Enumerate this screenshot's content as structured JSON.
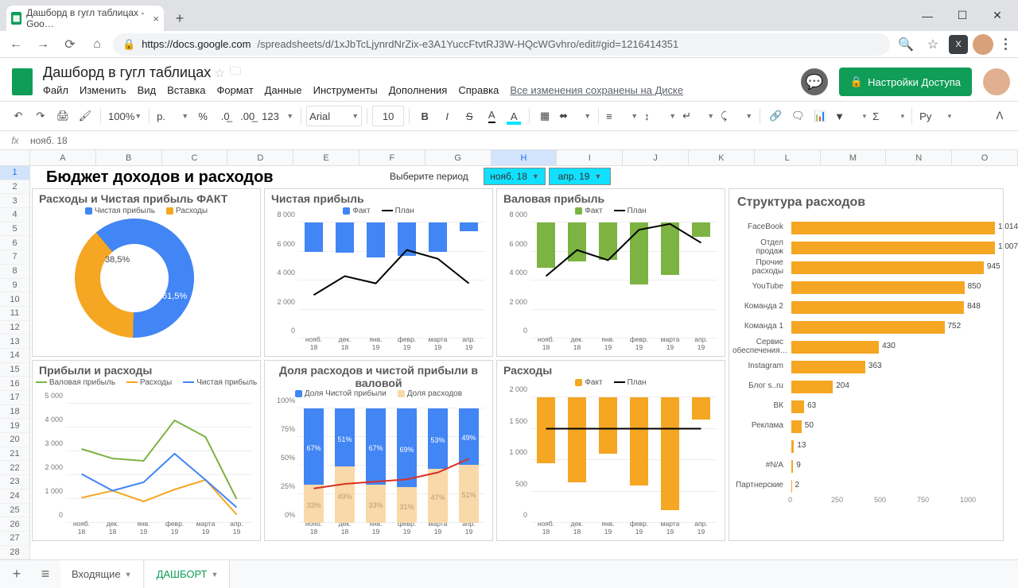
{
  "browser": {
    "tab_title": "Дашборд в гугл таблицах - Goo…",
    "url_host": "https://docs.google.com",
    "url_path": "/spreadsheets/d/1xJbTcLjynrdNrZix-e3A1YuccFtvtRJ3W-HQcWGvhro/edit#gid=1216414351"
  },
  "sheets": {
    "doc_title": "Дашборд в гугл таблицах",
    "menu": [
      "Файл",
      "Изменить",
      "Вид",
      "Вставка",
      "Формат",
      "Данные",
      "Инструменты",
      "Дополнения",
      "Справка"
    ],
    "saved_text": "Все изменения сохранены на Диске",
    "share_label": "Настройки Доступа",
    "font_name": "Arial",
    "font_size": "10",
    "zoom": "100%",
    "currency": "р.",
    "script_label": "Ру",
    "formula_cell": "нояб. 18",
    "tab_incoming": "Входящие",
    "tab_dashboard": "ДАШБОРТ"
  },
  "grid": {
    "cols": [
      "A",
      "B",
      "C",
      "D",
      "E",
      "F",
      "G",
      "H",
      "I",
      "J",
      "K",
      "L",
      "M",
      "N",
      "O"
    ],
    "selected_col_idx": 7,
    "rows": 28
  },
  "dashboard_title": "Бюджет доходов и расходов",
  "period_label": "Выберите период",
  "period_from": "нояб. 18",
  "period_to": "апр. 19",
  "months": [
    "нояб. 18",
    "дек. 18",
    "янв. 19",
    "февр. 19",
    "марта 19",
    "апр. 19"
  ],
  "box1": {
    "title": "Расходы и Чистая прибыль ФАКТ",
    "legend_profit": "Чистая прибыль",
    "legend_expense": "Расходы"
  },
  "box2": {
    "title": "Чистая прибыль",
    "legend_fact": "Факт",
    "legend_plan": "План"
  },
  "box3": {
    "title": "Валовая прибыль",
    "legend_fact": "Факт",
    "legend_plan": "План"
  },
  "box4": {
    "title": "Прибыли и расходы",
    "legend_gross": "Валовая прибыль",
    "legend_expense": "Расходы",
    "legend_net": "Чистая прибыль"
  },
  "box5": {
    "title": "Доля расходов и чистой прибыли в валовой",
    "legend_profit": "Доля Чистой прибыли",
    "legend_expense": "Доля расходов"
  },
  "box6": {
    "title": "Расходы",
    "legend_fact": "Факт",
    "legend_plan": "План"
  },
  "box7": {
    "title": "Структура расходов"
  },
  "chart_data": [
    {
      "id": "donut_fact",
      "type": "pie",
      "title": "Расходы и Чистая прибыль ФАКТ",
      "series": [
        {
          "name": "Чистая прибыль",
          "value": 61.5,
          "color": "#4285f4"
        },
        {
          "name": "Расходы",
          "value": 38.5,
          "color": "#f5a623"
        }
      ],
      "labels": [
        "61,5%",
        "38,5%"
      ]
    },
    {
      "id": "net_profit",
      "type": "bar+line",
      "title": "Чистая прибыль",
      "categories": [
        "нояб. 18",
        "дек. 18",
        "янв. 19",
        "февр. 19",
        "марта 19",
        "апр. 19"
      ],
      "series": [
        {
          "name": "Факт",
          "type": "bar",
          "color": "#4285f4",
          "values": [
            2000,
            2100,
            2400,
            2300,
            2000,
            600
          ]
        },
        {
          "name": "План",
          "type": "line",
          "color": "#000",
          "values": [
            3000,
            4300,
            3800,
            6100,
            5500,
            3800
          ]
        }
      ],
      "ylim": [
        0,
        8000
      ],
      "yticks": [
        0,
        2000,
        4000,
        6000,
        8000
      ]
    },
    {
      "id": "gross_profit",
      "type": "bar+line",
      "title": "Валовая прибыль",
      "categories": [
        "нояб. 18",
        "дек. 18",
        "янв. 19",
        "февр. 19",
        "марта 19",
        "апр. 19"
      ],
      "series": [
        {
          "name": "Факт",
          "type": "bar",
          "color": "#7cb342",
          "values": [
            3100,
            2700,
            2600,
            4300,
            3600,
            1000
          ]
        },
        {
          "name": "План",
          "type": "line",
          "color": "#000",
          "values": [
            4300,
            6100,
            5400,
            7500,
            7900,
            6600
          ]
        }
      ],
      "ylim": [
        0,
        8000
      ],
      "yticks": [
        0,
        2000,
        4000,
        6000,
        8000
      ]
    },
    {
      "id": "profits_expenses",
      "type": "line",
      "title": "Прибыли и расходы",
      "categories": [
        "нояб. 18",
        "дек. 18",
        "янв. 19",
        "февр. 19",
        "марта 19",
        "апр. 19"
      ],
      "series": [
        {
          "name": "Валовая прибыль",
          "color": "#7cb342",
          "values": [
            3100,
            2700,
            2600,
            4300,
            3600,
            1000
          ]
        },
        {
          "name": "Расходы",
          "color": "#f5a623",
          "values": [
            1050,
            1350,
            900,
            1400,
            1800,
            350
          ]
        },
        {
          "name": "Чистая прибыль",
          "color": "#4285f4",
          "values": [
            2050,
            1350,
            1700,
            2900,
            1800,
            650
          ]
        }
      ],
      "ylim": [
        0,
        5000
      ],
      "yticks": [
        0,
        1000,
        2000,
        3000,
        4000,
        5000
      ]
    },
    {
      "id": "share",
      "type": "stacked-bar+line",
      "title": "Доля расходов и чистой прибыли в валовой",
      "categories": [
        "нояб. 18",
        "дек. 18",
        "янв. 19",
        "февр. 19",
        "марта 19",
        "апр. 19"
      ],
      "series": [
        {
          "name": "Доля Чистой прибыли",
          "color": "#4285f4",
          "values": [
            67,
            51,
            67,
            69,
            53,
            49
          ]
        },
        {
          "name": "Доля расходов",
          "color": "#f9d9a9",
          "values": [
            33,
            49,
            33,
            31,
            47,
            51
          ]
        }
      ],
      "line_values": [
        30,
        34,
        36,
        38,
        44,
        56
      ],
      "ylim": [
        0,
        100
      ],
      "yticks": [
        0,
        25,
        50,
        75,
        100
      ],
      "ytick_labels": [
        "0%",
        "25%",
        "50%",
        "75%",
        "100%"
      ],
      "bar_labels_top": [
        "67%",
        "51%",
        "67%",
        "69%",
        "53%",
        "49%"
      ],
      "bar_labels_bot": [
        "33%",
        "49%",
        "33%",
        "31%",
        "47%",
        "51%"
      ]
    },
    {
      "id": "expenses",
      "type": "bar+line",
      "title": "Расходы",
      "categories": [
        "нояб. 18",
        "дек. 18",
        "янв. 19",
        "февр. 19",
        "марта 19",
        "апр. 19"
      ],
      "series": [
        {
          "name": "Факт",
          "color": "#f5a623",
          "values": [
            1050,
            1350,
            900,
            1400,
            1800,
            350
          ]
        },
        {
          "name": "План",
          "color": "#000",
          "values": [
            1500,
            1500,
            1500,
            1500,
            1500,
            1500
          ]
        }
      ],
      "ylim": [
        0,
        2000
      ],
      "yticks": [
        0,
        500,
        1000,
        1500,
        2000
      ]
    },
    {
      "id": "expense_structure",
      "type": "hbar",
      "title": "Структура расходов",
      "categories": [
        "FaceBook",
        "Отдел продаж",
        "Прочие расходы",
        "YouTube",
        "Команда 2",
        "Команда 1",
        "Сервис обеспечения…",
        "Instagram",
        "Блог s..ru",
        "ВК",
        "Реклама",
        "",
        "#N/A",
        "Партнерские"
      ],
      "values": [
        1014,
        1007,
        945,
        850,
        848,
        752,
        430,
        363,
        204,
        63,
        50,
        13,
        9,
        2
      ],
      "xlim": [
        0,
        1000
      ],
      "xticks": [
        0,
        250,
        500,
        750,
        1000
      ]
    }
  ]
}
